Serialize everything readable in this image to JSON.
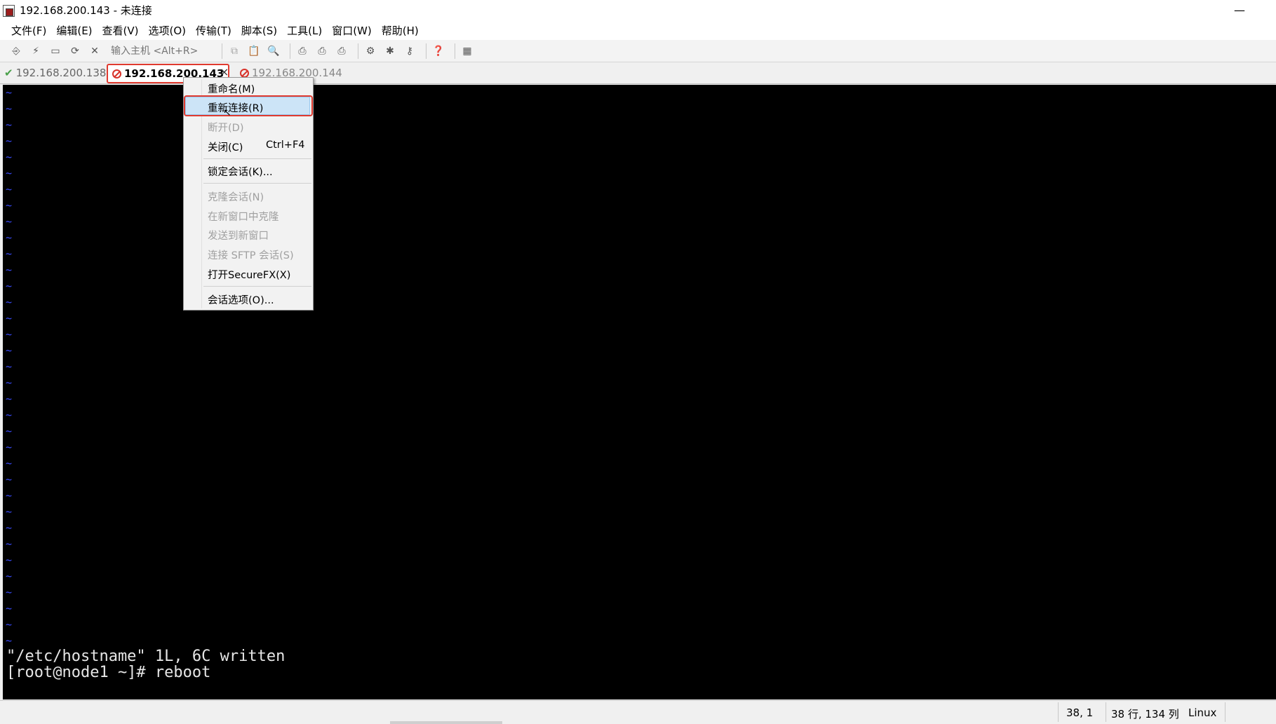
{
  "window": {
    "title": "192.168.200.143 - 未连接"
  },
  "menubar": [
    "文件(F)",
    "编辑(E)",
    "查看(V)",
    "选项(O)",
    "传输(T)",
    "脚本(S)",
    "工具(L)",
    "窗口(W)",
    "帮助(H)"
  ],
  "toolbar": {
    "host_placeholder": "输入主机 <Alt+R>"
  },
  "tabs": {
    "tab1": "192.168.200.138",
    "tab2": "192.168.200.143",
    "tab3": "192.168.200.144",
    "close_symbol": "×"
  },
  "context_menu": {
    "rename": "重命名(M)",
    "reconnect": "重新连接(R)",
    "disconnect": "断开(D)",
    "close": "关闭(C)",
    "close_shortcut": "Ctrl+F4",
    "lock": "锁定会话(K)...",
    "clone": "克隆会话(N)",
    "clone_new_window": "在新窗口中克隆",
    "send_new_window": "发送到新窗口",
    "sftp": "连接 SFTP 会话(S)",
    "securefx": "打开SecureFX(X)",
    "session_options": "会话选项(O)..."
  },
  "terminal": {
    "tilde": "~",
    "line1": "\"/etc/hostname\" 1L, 6C written",
    "line2": "[root@node1 ~]# reboot"
  },
  "statusbar": {
    "cursor_pos": "38,   1",
    "size": "38 行, 134 列",
    "os": "Linux"
  }
}
